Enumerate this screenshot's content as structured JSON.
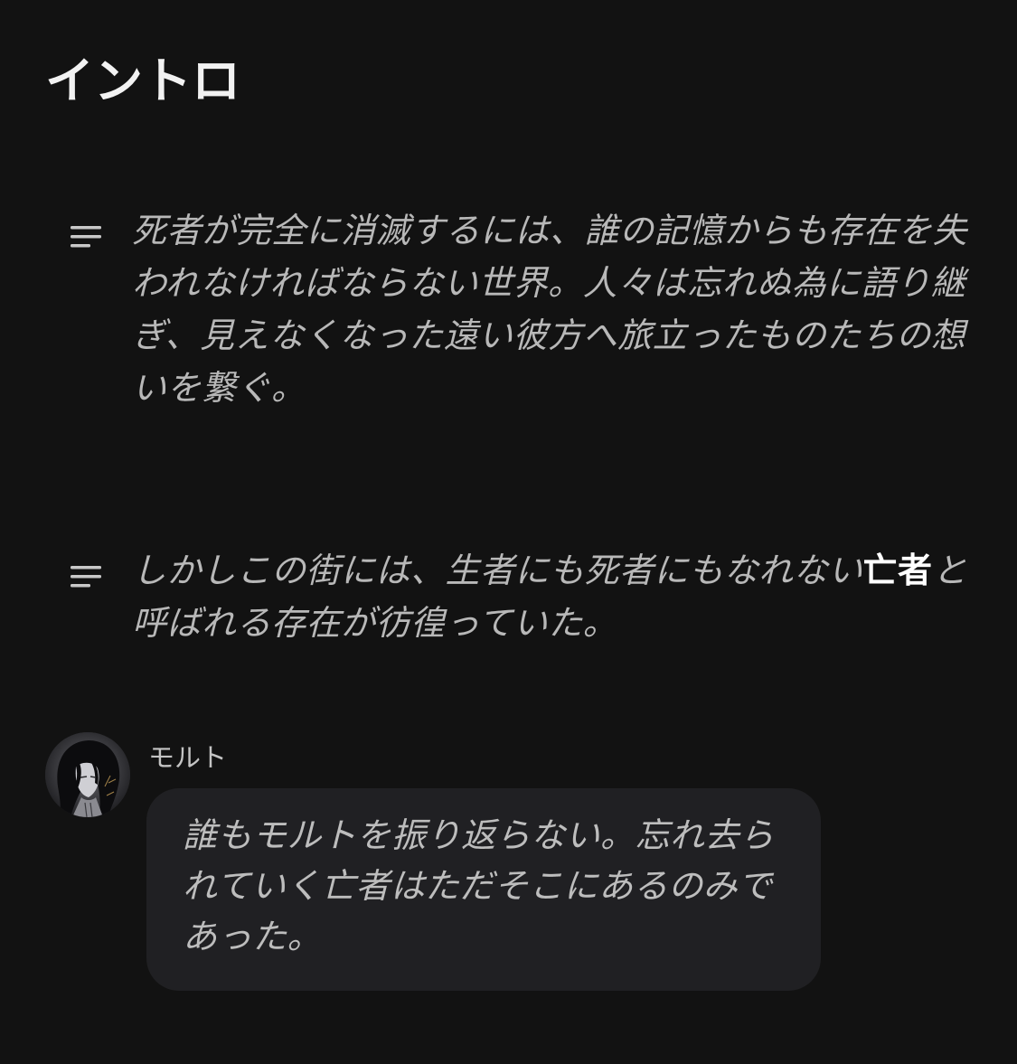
{
  "page": {
    "title": "イントロ"
  },
  "narrations": [
    {
      "icon": "text-lines-icon",
      "text": "死者が完全に消滅するには、誰の記憶からも存在を失われなければならない世界。人々は忘れぬ為に語り継ぎ、見えなくなった遠い彼方へ旅立ったものたちの想いを繋ぐ。"
    },
    {
      "icon": "text-lines-icon",
      "text_before": "しかしこの街には、生者にも死者にもなれない",
      "bold_term": "亡者",
      "text_after": "と呼ばれる存在が彷徨っていた。"
    }
  ],
  "message": {
    "avatar_icon": "character-avatar",
    "speaker": "モルト",
    "text": "誰もモルトを振り返らない。忘れ去られていく亡者はただそこにあるのみであった。"
  },
  "colors": {
    "background": "#121212",
    "title": "#f2f2f2",
    "body_text": "#b8b8b8",
    "bold_term": "#ffffff",
    "bubble": "#202023"
  }
}
